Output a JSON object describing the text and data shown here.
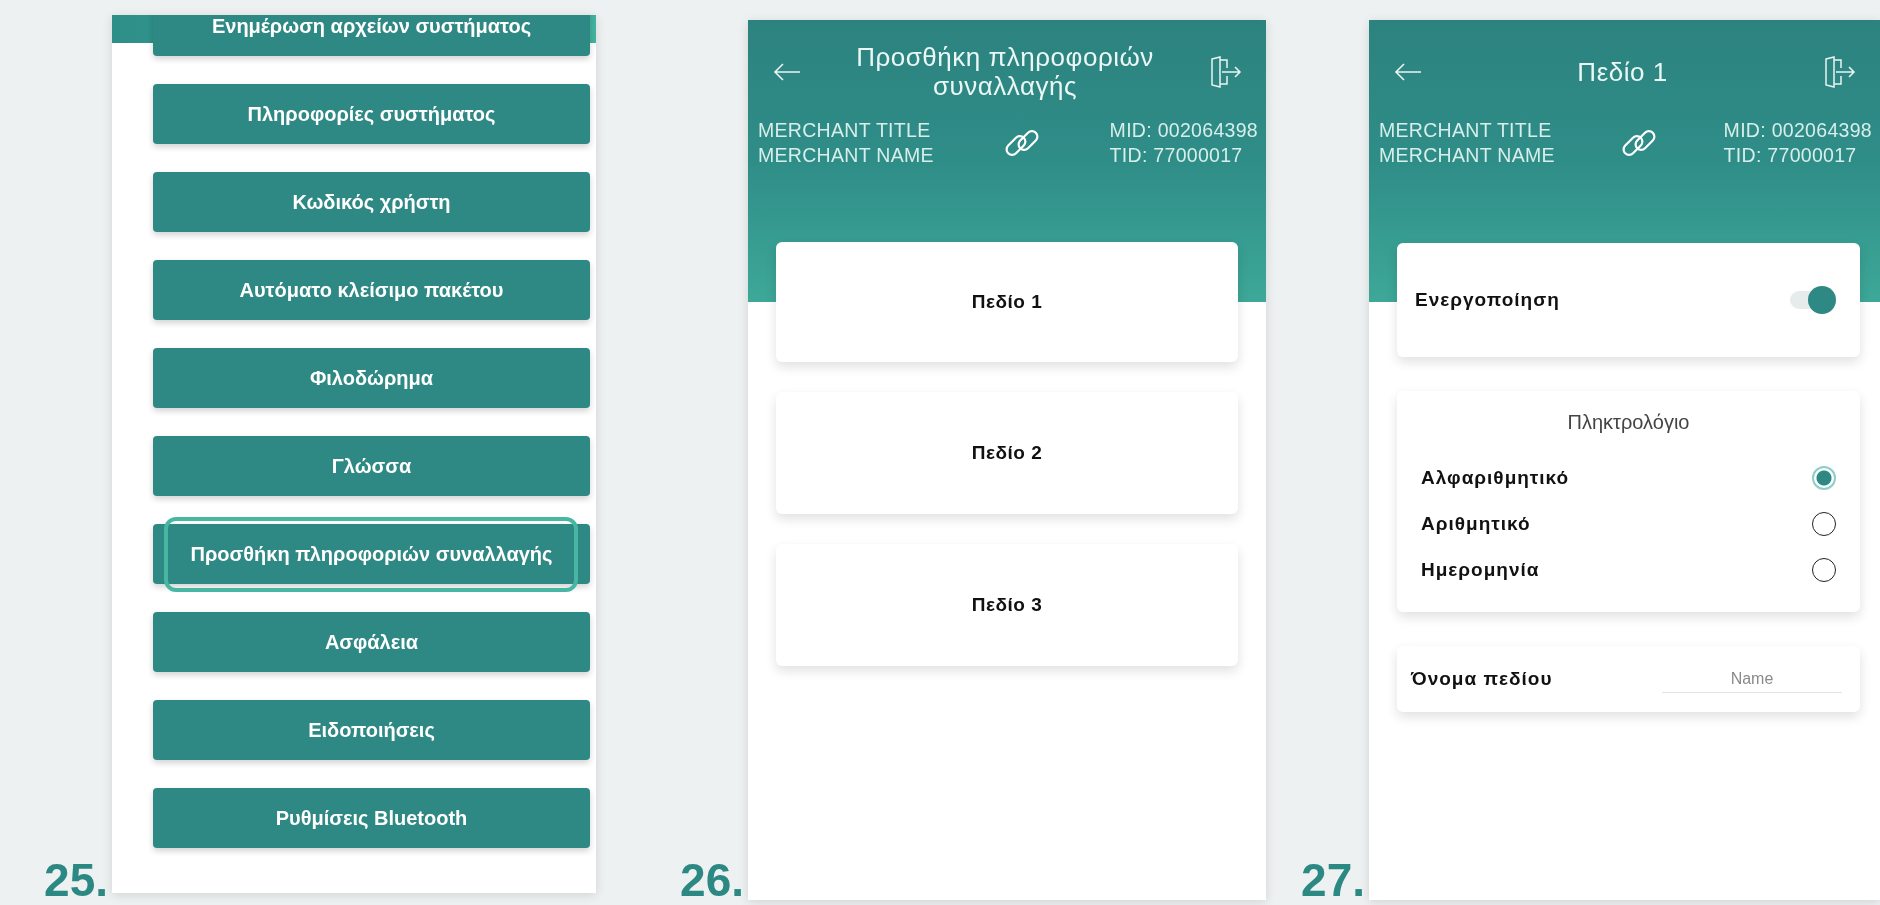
{
  "steps": [
    {
      "number": "25.",
      "screen": {
        "kind": "menu",
        "items": [
          {
            "label": "Ενημέρωση αρχείων συστήματος",
            "highlighted": false
          },
          {
            "label": "Πληροφορίες συστήματος",
            "highlighted": false
          },
          {
            "label": "Κωδικός χρήστη",
            "highlighted": false
          },
          {
            "label": "Αυτόματο κλείσιμο πακέτου",
            "highlighted": false
          },
          {
            "label": "Φιλοδώρημα",
            "highlighted": false
          },
          {
            "label": "Γλώσσα",
            "highlighted": false
          },
          {
            "label": "Προσθήκη πληροφοριών συναλλαγής",
            "highlighted": true
          },
          {
            "label": "Ασφάλεια",
            "highlighted": false
          },
          {
            "label": "Ειδοποιήσεις",
            "highlighted": false
          },
          {
            "label": "Ρυθμίσεις Bluetooth",
            "highlighted": false
          }
        ]
      }
    },
    {
      "number": "26.",
      "screen": {
        "kind": "list",
        "title": "Προσθήκη πληροφοριών συναλλαγής",
        "merchant": {
          "title": "MERCHANT TITLE",
          "name": "MERCHANT NAME",
          "mid": "MID: 002064398",
          "tid": "TID: 77000017"
        },
        "items": [
          {
            "label": "Πεδίο 1"
          },
          {
            "label": "Πεδίο 2"
          },
          {
            "label": "Πεδίο 3"
          }
        ]
      }
    },
    {
      "number": "27.",
      "screen": {
        "kind": "field",
        "title": "Πεδίο 1",
        "merchant": {
          "title": "MERCHANT TITLE",
          "name": "MERCHANT NAME",
          "mid": "MID: 002064398",
          "tid": "TID: 77000017"
        },
        "enable": {
          "label": "Ενεργοποίηση",
          "on": true
        },
        "keyboard": {
          "heading": "Πληκτρολόγιο",
          "options": [
            {
              "label": "Αλφαριθμητικό",
              "selected": true
            },
            {
              "label": "Αριθμητικό",
              "selected": false
            },
            {
              "label": "Ημερομηνία",
              "selected": false
            }
          ]
        },
        "name_field": {
          "label": "Όνομα πεδίου",
          "placeholder": "Name"
        }
      }
    }
  ]
}
